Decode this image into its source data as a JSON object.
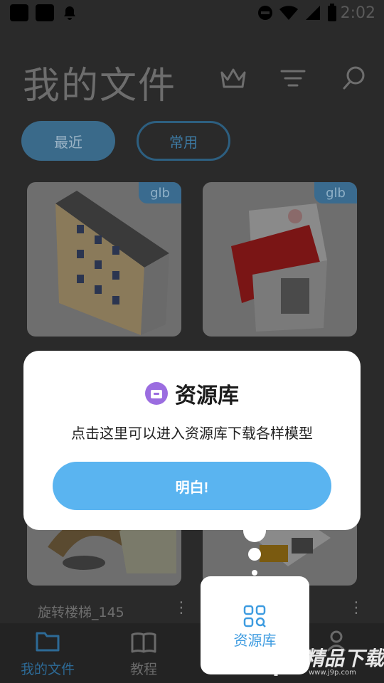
{
  "status_bar": {
    "time": "2:02"
  },
  "header": {
    "title": "我的文件",
    "icons": [
      "crown-icon",
      "filter-icon",
      "search-icon"
    ]
  },
  "chips": {
    "recent": "最近",
    "common": "常用"
  },
  "files": [
    {
      "badge": "glb",
      "name": ""
    },
    {
      "badge": "glb",
      "name": ""
    },
    {
      "badge": "",
      "name": "旋转楼梯_145"
    },
    {
      "badge": "",
      "name": ""
    }
  ],
  "bottom_nav": {
    "items": [
      {
        "label": "我的文件",
        "icon": "folder-icon",
        "active": true
      },
      {
        "label": "教程",
        "icon": "book-icon",
        "active": false
      },
      {
        "label": "",
        "icon": "user-icon",
        "active": false
      }
    ]
  },
  "popup": {
    "title": "资源库",
    "description": "点击这里可以进入资源库下载各样模型",
    "button": "明白!"
  },
  "resource_entry": {
    "label": "资源库",
    "icon": "grid-search-icon"
  },
  "watermark": {
    "text": "精品下载",
    "url_text": "www.j9p.com"
  },
  "colors": {
    "accent": "#5ab4f0",
    "accent_text": "#3d9be0",
    "popup_bg": "#ffffff",
    "icon_purple": "#9b6de0"
  }
}
